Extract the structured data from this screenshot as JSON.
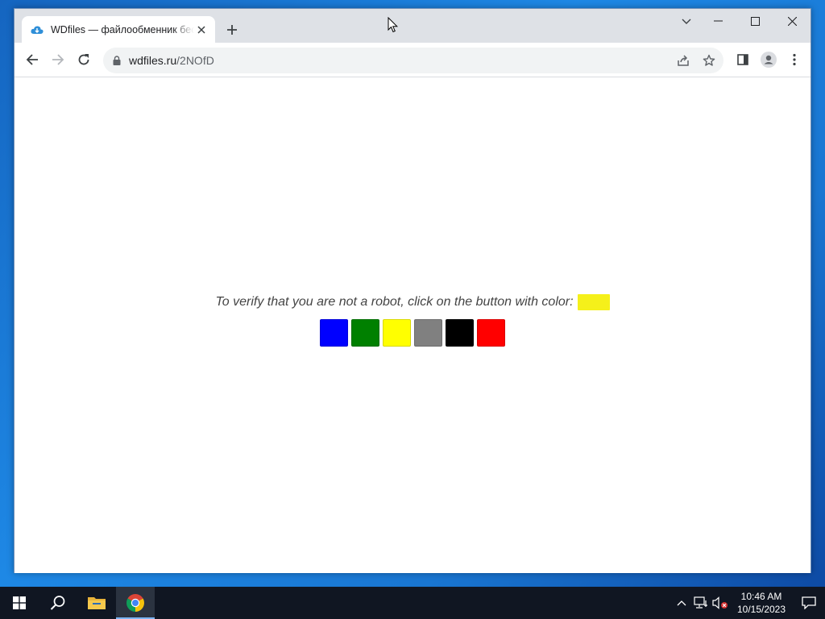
{
  "browser": {
    "tab": {
      "title": "WDfiles — файлообменник бесплатный",
      "favicon": "cloud-favicon-icon"
    },
    "address_bar": {
      "host": "wdfiles.ru",
      "path": "/2NOfD"
    },
    "icons": {
      "back": "arrow-left-icon",
      "forward": "arrow-right-icon",
      "reload": "reload-icon",
      "lock": "lock-icon",
      "share": "share-icon",
      "bookmark": "star-icon",
      "side_panel": "side-panel-icon",
      "profile": "profile-icon",
      "menu": "kebab-menu-icon"
    }
  },
  "page": {
    "prompt": "To verify that you are not a robot, click on the button with color:",
    "target_color": "#f5f01a",
    "color_buttons": [
      {
        "name": "blue",
        "color": "#0000ff"
      },
      {
        "name": "green",
        "color": "#008000"
      },
      {
        "name": "yellow",
        "color": "#ffff00"
      },
      {
        "name": "gray",
        "color": "#808080"
      },
      {
        "name": "black",
        "color": "#000000"
      },
      {
        "name": "red",
        "color": "#ff0000"
      }
    ]
  },
  "taskbar": {
    "time": "10:46 AM",
    "date": "10/15/2023"
  }
}
